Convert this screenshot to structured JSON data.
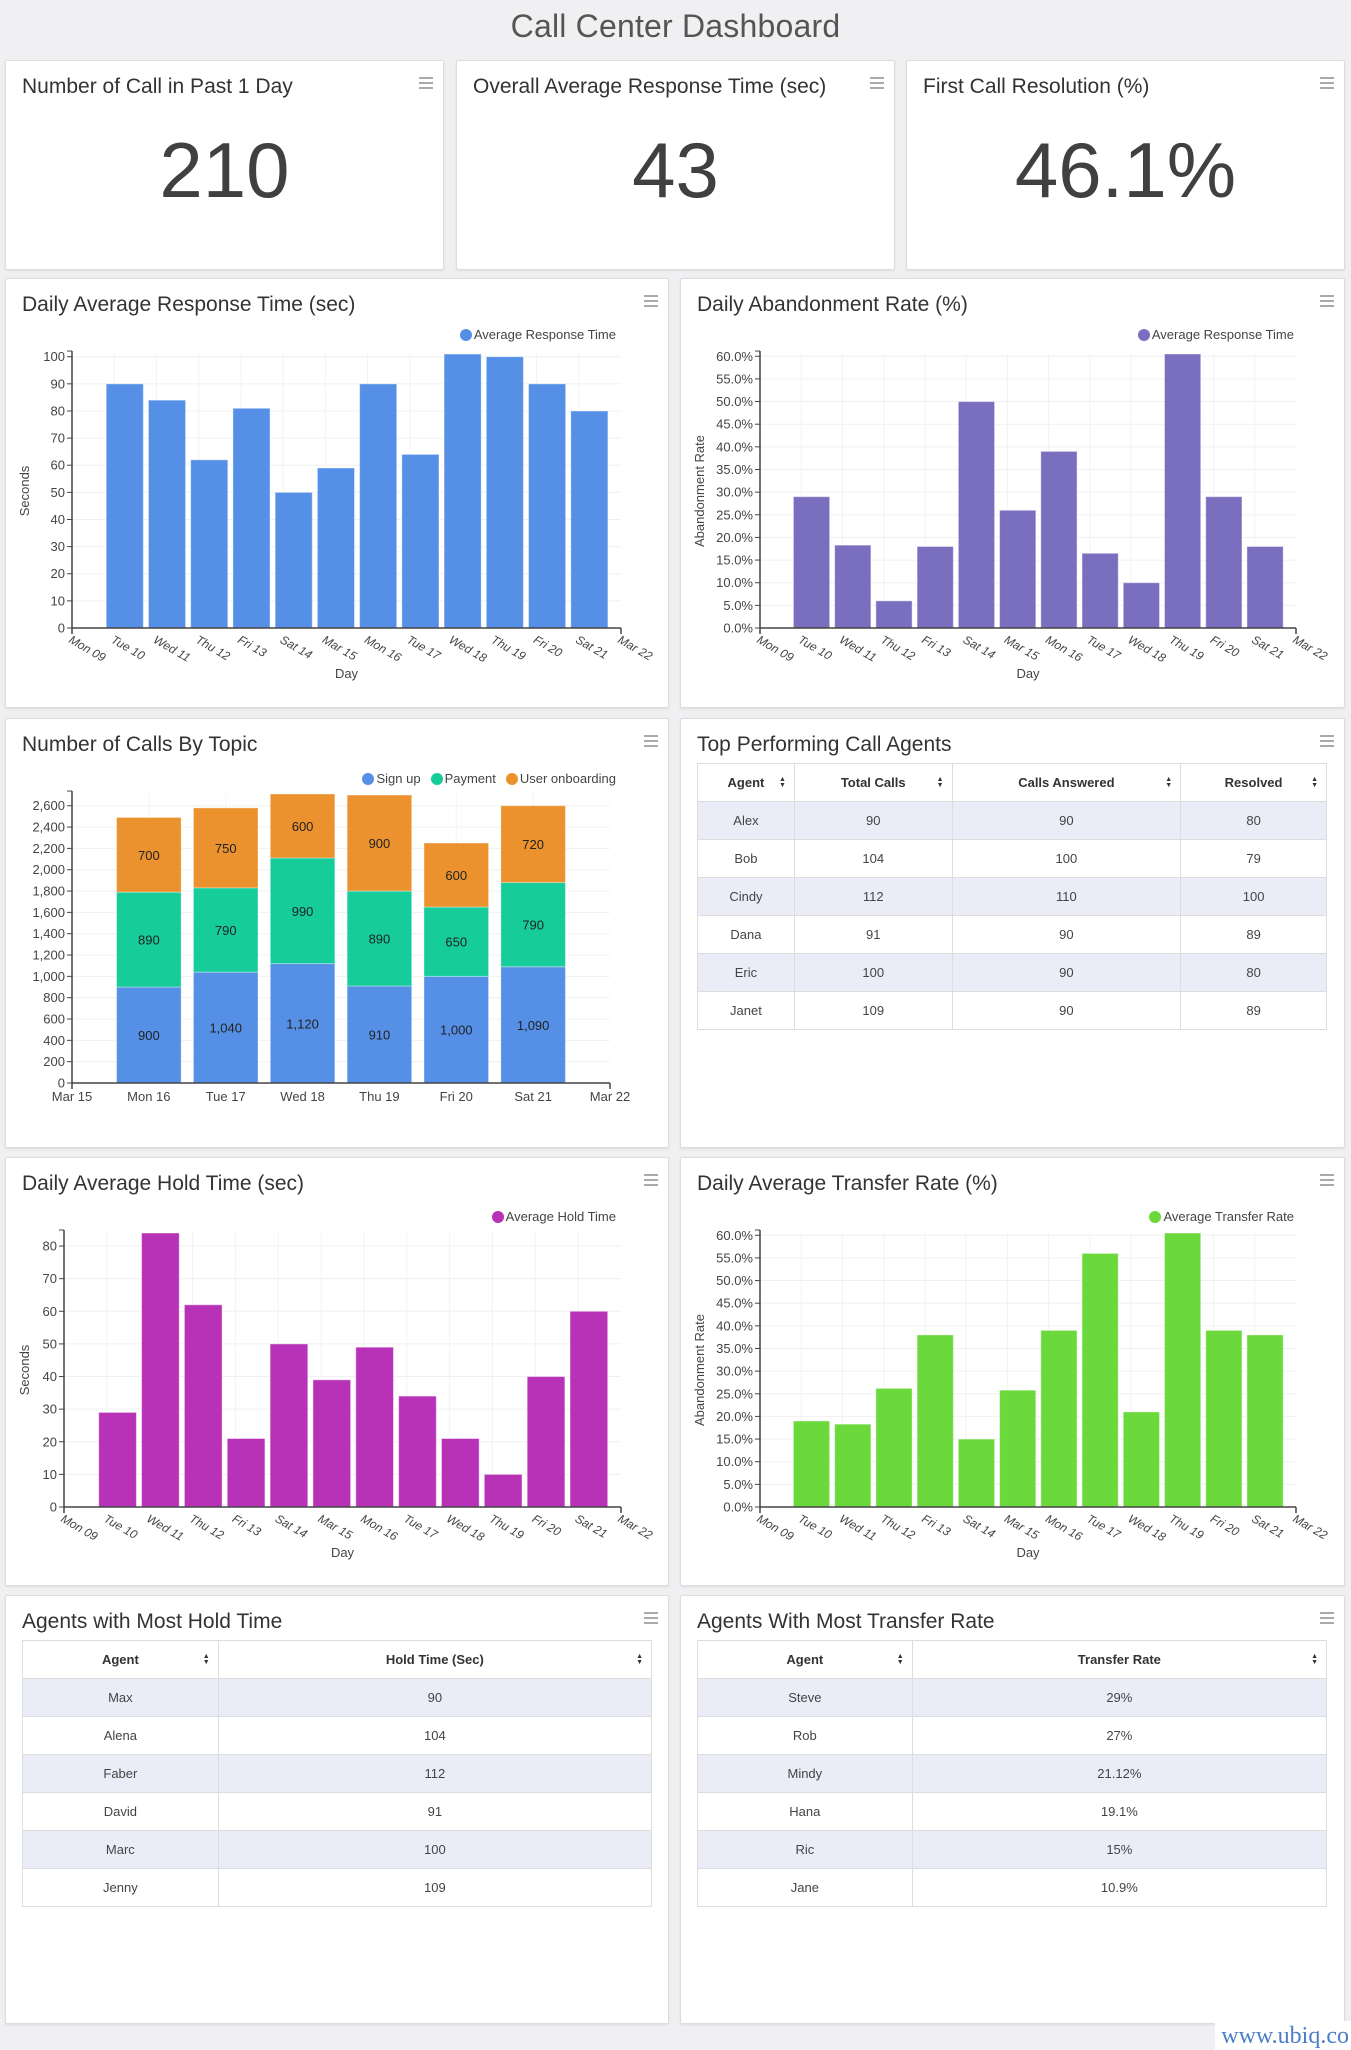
{
  "page": {
    "title": "Call Center Dashboard",
    "watermark": "www.ubiq.co"
  },
  "kpis": [
    {
      "title": "Number of Call in Past 1 Day",
      "value": "210"
    },
    {
      "title": "Overall Average Response Time (sec)",
      "value": "43"
    },
    {
      "title": "First Call Resolution (%)",
      "value": "46.1%"
    }
  ],
  "icons": {
    "menu": "hamburger-menu-icon",
    "sort": "sort-updown-icon",
    "legend": "circle-marker-icon"
  },
  "colors": {
    "response": "#5590e6",
    "abandonment": "#7a6fbe",
    "signup": "#5590e6",
    "payment": "#16cc9a",
    "onboarding": "#eb922f",
    "hold": "#b832b8",
    "transfer": "#6bd93c",
    "stripe": "#eaedf7",
    "watermark": "#4a7ec7"
  },
  "chart_data": [
    {
      "id": "response",
      "type": "bar",
      "title": "Daily Average Response Time (sec)",
      "legend": [
        "Average Response Time"
      ],
      "legend_position": "top-right",
      "xlabel": "Day",
      "ylabel": "Seconds",
      "x_ticks": [
        "Mon 09",
        "Tue 10",
        "Wed 11",
        "Thu 12",
        "Fri 13",
        "Sat 14",
        "Mar 15",
        "Mon 16",
        "Tue 17",
        "Wed 18",
        "Thu 19",
        "Fri 20",
        "Sat 21",
        "Mar 22"
      ],
      "categories": [
        "Tue 10",
        "Wed 11",
        "Thu 12",
        "Fri 13",
        "Sat 14",
        "Mar 15",
        "Mon 16",
        "Tue 17",
        "Wed 18",
        "Thu 19",
        "Fri 20",
        "Sat 21"
      ],
      "values": [
        90,
        84,
        62,
        81,
        50,
        59,
        90,
        64,
        101,
        100,
        90,
        80
      ],
      "y_ticks": [
        "0",
        "10",
        "20",
        "30",
        "40",
        "50",
        "60",
        "70",
        "80",
        "90",
        "100"
      ],
      "ylim": [
        0,
        101
      ],
      "grid": true
    },
    {
      "id": "abandonment",
      "type": "bar",
      "title": "Daily Abandonment Rate (%)",
      "legend": [
        "Average Response Time"
      ],
      "legend_position": "top-right",
      "xlabel": "Day",
      "ylabel": "Abandonment Rate",
      "x_ticks": [
        "Mon 09",
        "Tue 10",
        "Wed 11",
        "Thu 12",
        "Fri 13",
        "Sat 14",
        "Mar 15",
        "Mon 16",
        "Tue 17",
        "Wed 18",
        "Thu 19",
        "Fri 20",
        "Sat 21",
        "Mar 22"
      ],
      "categories": [
        "Tue 10",
        "Wed 11",
        "Thu 12",
        "Fri 13",
        "Sat 14",
        "Mar 15",
        "Mon 16",
        "Tue 17",
        "Wed 18",
        "Thu 19",
        "Fri 20",
        "Sat 21"
      ],
      "values": [
        29,
        18.3,
        6,
        18,
        50,
        26,
        39,
        16.5,
        10,
        60.5,
        29,
        18
      ],
      "y_ticks": [
        "0.0%",
        "5.0%",
        "10.0%",
        "15.0%",
        "20.0%",
        "25.0%",
        "30.0%",
        "35.0%",
        "40.0%",
        "45.0%",
        "50.0%",
        "55.0%",
        "60.0%"
      ],
      "ylim": [
        0,
        60.5
      ],
      "grid": true
    },
    {
      "id": "topics",
      "type": "bar",
      "stacked": true,
      "title": "Number of Calls By Topic",
      "legend_position": "top-right",
      "x_ticks": [
        "Mar 15",
        "Mon 16",
        "Tue 17",
        "Wed 18",
        "Thu 19",
        "Fri 20",
        "Sat 21",
        "Mar 22"
      ],
      "categories": [
        "Mon 16",
        "Tue 17",
        "Wed 18",
        "Thu 19",
        "Fri 20",
        "Sat 21"
      ],
      "series": [
        {
          "name": "Sign up",
          "values": [
            900,
            1040,
            1120,
            910,
            1000,
            1090
          ],
          "labels": [
            "900",
            "1,040",
            "1,120",
            "910",
            "1,000",
            "1,090"
          ]
        },
        {
          "name": "Payment",
          "values": [
            890,
            790,
            990,
            890,
            650,
            790
          ],
          "labels": [
            "890",
            "790",
            "990",
            "890",
            "650",
            "790"
          ]
        },
        {
          "name": "User onboarding",
          "values": [
            700,
            750,
            600,
            900,
            600,
            720
          ],
          "labels": [
            "700",
            "750",
            "600",
            "900",
            "600",
            "720"
          ]
        }
      ],
      "y_ticks": [
        "0",
        "200",
        "400",
        "600",
        "800",
        "1,000",
        "1,200",
        "1,400",
        "1,600",
        "1,800",
        "2,000",
        "2,200",
        "2,400",
        "2,600"
      ],
      "ylim": [
        0,
        2710
      ],
      "grid": true
    },
    {
      "id": "hold",
      "type": "bar",
      "title": "Daily Average Hold Time (sec)",
      "legend": [
        "Average Hold Time"
      ],
      "legend_position": "top-right",
      "xlabel": "Day",
      "ylabel": "Seconds",
      "x_ticks": [
        "Mon 09",
        "Tue 10",
        "Wed 11",
        "Thu 12",
        "Fri 13",
        "Sat 14",
        "Mar 15",
        "Mon 16",
        "Tue 17",
        "Wed 18",
        "Thu 19",
        "Fri 20",
        "Sat 21",
        "Mar 22"
      ],
      "categories": [
        "Tue 10",
        "Wed 11",
        "Thu 12",
        "Fri 13",
        "Sat 14",
        "Mar 15",
        "Mon 16",
        "Tue 17",
        "Wed 18",
        "Thu 19",
        "Fri 20",
        "Sat 21"
      ],
      "values": [
        29,
        84,
        62,
        21,
        50,
        39,
        49,
        34,
        21,
        10,
        40,
        60
      ],
      "y_ticks": [
        "0",
        "10",
        "20",
        "30",
        "40",
        "50",
        "60",
        "70",
        "80"
      ],
      "ylim": [
        0,
        84
      ],
      "grid": true
    },
    {
      "id": "transfer",
      "type": "bar",
      "title": "Daily Average Transfer Rate (%)",
      "legend": [
        "Average Transfer Rate"
      ],
      "legend_position": "top-right",
      "xlabel": "Day",
      "ylabel": "Abandonment Rate",
      "x_ticks": [
        "Mon 09",
        "Tue 10",
        "Wed 11",
        "Thu 12",
        "Fri 13",
        "Sat 14",
        "Mar 15",
        "Mon 16",
        "Tue 17",
        "Wed 18",
        "Thu 19",
        "Fri 20",
        "Sat 21",
        "Mar 22"
      ],
      "categories": [
        "Tue 10",
        "Wed 11",
        "Thu 12",
        "Fri 13",
        "Sat 14",
        "Mar 15",
        "Mon 16",
        "Tue 17",
        "Wed 18",
        "Thu 19",
        "Fri 20",
        "Sat 21"
      ],
      "values": [
        19,
        18.3,
        26.2,
        38,
        15,
        25.8,
        39,
        56,
        21,
        60.5,
        39,
        38
      ],
      "y_ticks": [
        "0.0%",
        "5.0%",
        "10.0%",
        "15.0%",
        "20.0%",
        "25.0%",
        "30.0%",
        "35.0%",
        "40.0%",
        "45.0%",
        "50.0%",
        "55.0%",
        "60.0%"
      ],
      "ylim": [
        0,
        60.5
      ],
      "grid": true
    }
  ],
  "tables": {
    "top_agents": {
      "title": "Top Performing Call Agents",
      "columns": [
        "Agent",
        "Total Calls",
        "Calls Answered",
        "Resolved"
      ],
      "rows": [
        [
          "Alex",
          "90",
          "90",
          "80"
        ],
        [
          "Bob",
          "104",
          "100",
          "79"
        ],
        [
          "Cindy",
          "112",
          "110",
          "100"
        ],
        [
          "Dana",
          "91",
          "90",
          "89"
        ],
        [
          "Eric",
          "100",
          "90",
          "80"
        ],
        [
          "Janet",
          "109",
          "90",
          "89"
        ]
      ]
    },
    "hold_agents": {
      "title": "Agents with Most Hold Time",
      "columns": [
        "Agent",
        "Hold Time (Sec)"
      ],
      "rows": [
        [
          "Max",
          "90"
        ],
        [
          "Alena",
          "104"
        ],
        [
          "Faber",
          "112"
        ],
        [
          "David",
          "91"
        ],
        [
          "Marc",
          "100"
        ],
        [
          "Jenny",
          "109"
        ]
      ]
    },
    "transfer_agents": {
      "title": "Agents With Most Transfer Rate",
      "columns": [
        "Agent",
        "Transfer Rate"
      ],
      "rows": [
        [
          "Steve",
          "29%"
        ],
        [
          "Rob",
          "27%"
        ],
        [
          "Mindy",
          "21.12%"
        ],
        [
          "Hana",
          "19.1%"
        ],
        [
          "Ric",
          "15%"
        ],
        [
          "Jane",
          "10.9%"
        ]
      ]
    }
  }
}
